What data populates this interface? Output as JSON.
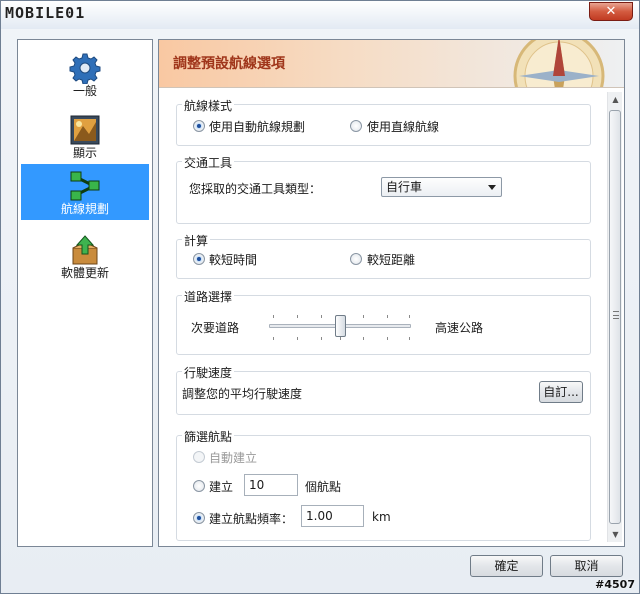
{
  "window": {
    "brand": "MOBILE01",
    "close_symbol": "✕"
  },
  "sidebar": {
    "items": [
      {
        "label": "一般",
        "icon": "gear-icon"
      },
      {
        "label": "顯示",
        "icon": "display-icon"
      },
      {
        "label": "航線規劃",
        "icon": "route-icon",
        "active": true
      },
      {
        "label": "軟體更新",
        "icon": "update-icon"
      }
    ]
  },
  "header": {
    "title": "調整預設航線選項"
  },
  "route_style": {
    "title": "航線樣式",
    "option_auto": "使用自動航線規劃",
    "option_straight": "使用直線航線",
    "selected": "option_auto"
  },
  "transport": {
    "title": "交通工具",
    "prompt": "您採取的交通工具類型：",
    "selected_value": "自行車"
  },
  "calculation": {
    "title": "計算",
    "option_time": "較短時間",
    "option_distance": "較短距離",
    "selected": "option_time"
  },
  "road": {
    "title": "道路選擇",
    "left_label": "次要道路",
    "right_label": "高速公路",
    "slider_value": 0.5
  },
  "speed": {
    "title": "行駛速度",
    "text": "調整您的平均行駛速度",
    "button_label": "自訂..."
  },
  "waypoints": {
    "title": "篩選航點",
    "option_auto": "自動建立",
    "option_create": "建立",
    "count_value": "10",
    "count_unit": "個航點",
    "option_frequency": "建立航點頻率：",
    "frequency_value": "1.00",
    "frequency_unit": "km",
    "selected": "option_frequency"
  },
  "footer": {
    "ok_label": "確定",
    "cancel_label": "取消"
  },
  "watermark": "#4507",
  "colors": {
    "active_nav": "#3399ff",
    "header_title": "#a0361b"
  }
}
